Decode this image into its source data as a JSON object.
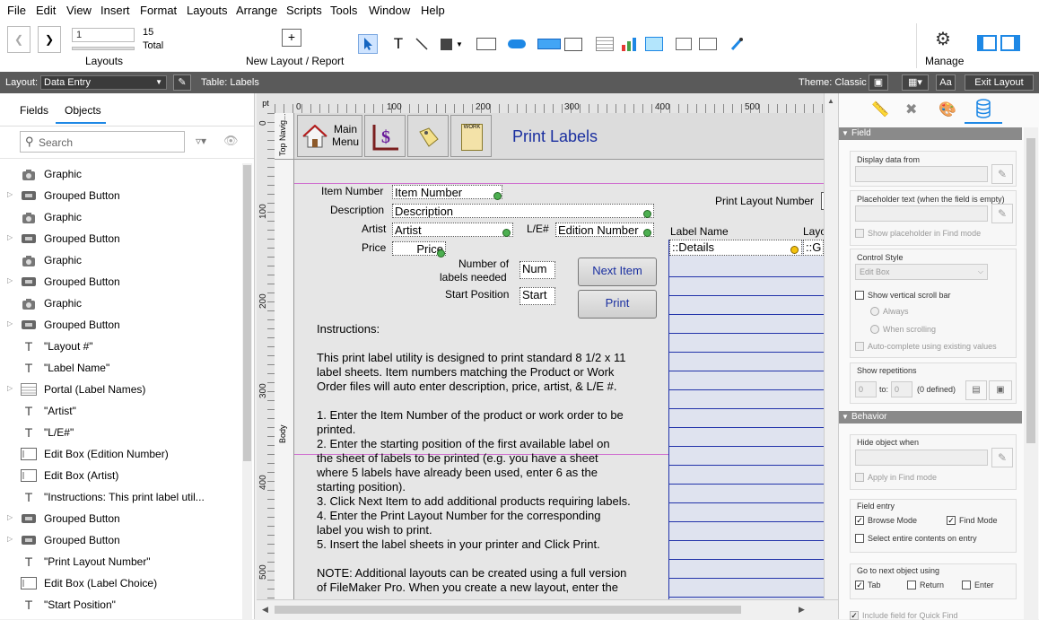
{
  "menu": [
    "File",
    "Edit",
    "View",
    "Insert",
    "Format",
    "Layouts",
    "Arrange",
    "Scripts",
    "Tools",
    "Window",
    "Help"
  ],
  "toolbar": {
    "record_input": "1",
    "record_count": "15",
    "total_label": "Total",
    "layouts_label": "Layouts",
    "new_layout_label": "New Layout / Report",
    "manage_label": "Manage"
  },
  "layoutbar": {
    "layout_label": "Layout:",
    "layout_value": "Data Entry",
    "table_label": "Table: Labels",
    "theme_label": "Theme: Classic",
    "exit_label": "Exit Layout"
  },
  "left_panel": {
    "tabs": [
      "Fields",
      "Objects"
    ],
    "search_placeholder": "Search",
    "objects": [
      {
        "icon": "camera-icon",
        "label": "Graphic",
        "expandable": false
      },
      {
        "icon": "button-icon",
        "label": "Grouped Button",
        "expandable": true
      },
      {
        "icon": "camera-icon",
        "label": "Graphic",
        "expandable": false
      },
      {
        "icon": "button-icon",
        "label": "Grouped Button",
        "expandable": true
      },
      {
        "icon": "camera-icon",
        "label": "Graphic",
        "expandable": false
      },
      {
        "icon": "button-icon",
        "label": "Grouped Button",
        "expandable": true
      },
      {
        "icon": "camera-icon",
        "label": "Graphic",
        "expandable": false
      },
      {
        "icon": "button-icon",
        "label": "Grouped Button",
        "expandable": true
      },
      {
        "icon": "text-icon",
        "label": "\"Layout #\"",
        "expandable": false
      },
      {
        "icon": "text-icon",
        "label": "\"Label Name\"",
        "expandable": false
      },
      {
        "icon": "portal-icon",
        "label": "Portal (Label Names)",
        "expandable": true
      },
      {
        "icon": "text-icon",
        "label": "\"Artist\"",
        "expandable": false
      },
      {
        "icon": "text-icon",
        "label": "\"L/E#\"",
        "expandable": false
      },
      {
        "icon": "editbox-icon",
        "label": "Edit Box (Edition Number)",
        "expandable": false
      },
      {
        "icon": "editbox-icon",
        "label": "Edit Box (Artist)",
        "expandable": false
      },
      {
        "icon": "text-icon",
        "label": "\"Instructions: This print label util...",
        "expandable": false
      },
      {
        "icon": "button-icon",
        "label": "Grouped Button",
        "expandable": true
      },
      {
        "icon": "button-icon",
        "label": "Grouped Button",
        "expandable": true
      },
      {
        "icon": "text-icon",
        "label": "\"Print Layout Number\"",
        "expandable": false
      },
      {
        "icon": "editbox-icon",
        "label": "Edit Box (Label Choice)",
        "expandable": false
      },
      {
        "icon": "text-icon",
        "label": "\"Start Position\"",
        "expandable": false
      }
    ]
  },
  "ruler": {
    "unit": "pt",
    "h_ticks": [
      "0",
      "100",
      "200",
      "300",
      "400",
      "500"
    ],
    "v_ticks": [
      "0",
      "100",
      "200",
      "300",
      "400",
      "500"
    ],
    "top_part": "Top Navig...",
    "body_part": "Body"
  },
  "canvas": {
    "main_menu_label": "Main Menu",
    "title": "Print Labels",
    "work_label": "WORK",
    "item_number_label": "Item Number",
    "item_number_field": "Item Number",
    "description_label": "Description",
    "description_field": "Description",
    "artist_label": "Artist",
    "artist_field": "Artist",
    "le_label": "L/E#",
    "edition_field": "Edition Number",
    "price_label": "Price",
    "price_field": "Price",
    "num_labels_label_1": "Number of",
    "num_labels_label_2": "labels needed",
    "num_field": "Num",
    "start_position_label": "Start Position",
    "start_field": "Start",
    "next_item_button": "Next Item",
    "print_button": "Print",
    "print_layout_number_label": "Print Layout Number",
    "label_name_header": "Label Name",
    "layout_header": "Layo",
    "details_field": "::Details",
    "g_field": "::G",
    "instructions": [
      "Instructions:",
      "",
      "This print label utility is designed to print standard 8 1/2 x 11",
      "label sheets.  Item numbers matching the Product or Work",
      "Order files will auto enter description, price, artist, & L/E #.",
      "",
      "1. Enter the Item Number of the product or work order to be",
      "printed.",
      "2. Enter the starting position of the first available label on",
      "the sheet of labels to be printed (e.g. you have a sheet",
      "where 5 labels have already been used, enter 6 as the",
      "starting position).",
      "3. Click Next Item to add additional products requiring labels.",
      "4. Enter the Print Layout Number for the corresponding",
      "label you wish to print.",
      "5. Insert the label sheets in your printer and Click Print.",
      "",
      "NOTE: Additional layouts can be created using a full version",
      "of FileMaker Pro. When you create a new layout, enter the"
    ]
  },
  "right_panel": {
    "field_section": "Field",
    "display_data_from": "Display data from",
    "placeholder_text": "Placeholder text (when the field is empty)",
    "show_placeholder": "Show placeholder in Find mode",
    "control_style": "Control Style",
    "control_style_value": "Edit Box",
    "show_vscroll": "Show vertical scroll bar",
    "always": "Always",
    "when_scrolling": "When scrolling",
    "autocomplete": "Auto-complete using existing values",
    "show_repetitions": "Show repetitions",
    "rep_from": "0",
    "rep_to_label": "to:",
    "rep_to": "0",
    "rep_defined": "(0 defined)",
    "behavior_section": "Behavior",
    "hide_object_when": "Hide object when",
    "apply_find": "Apply in Find mode",
    "field_entry": "Field entry",
    "browse_mode": "Browse Mode",
    "find_mode": "Find Mode",
    "select_entire": "Select entire contents on entry",
    "go_next": "Go to next object using",
    "tab": "Tab",
    "return": "Return",
    "enter": "Enter",
    "quick_find": "Include field for Quick Find"
  }
}
